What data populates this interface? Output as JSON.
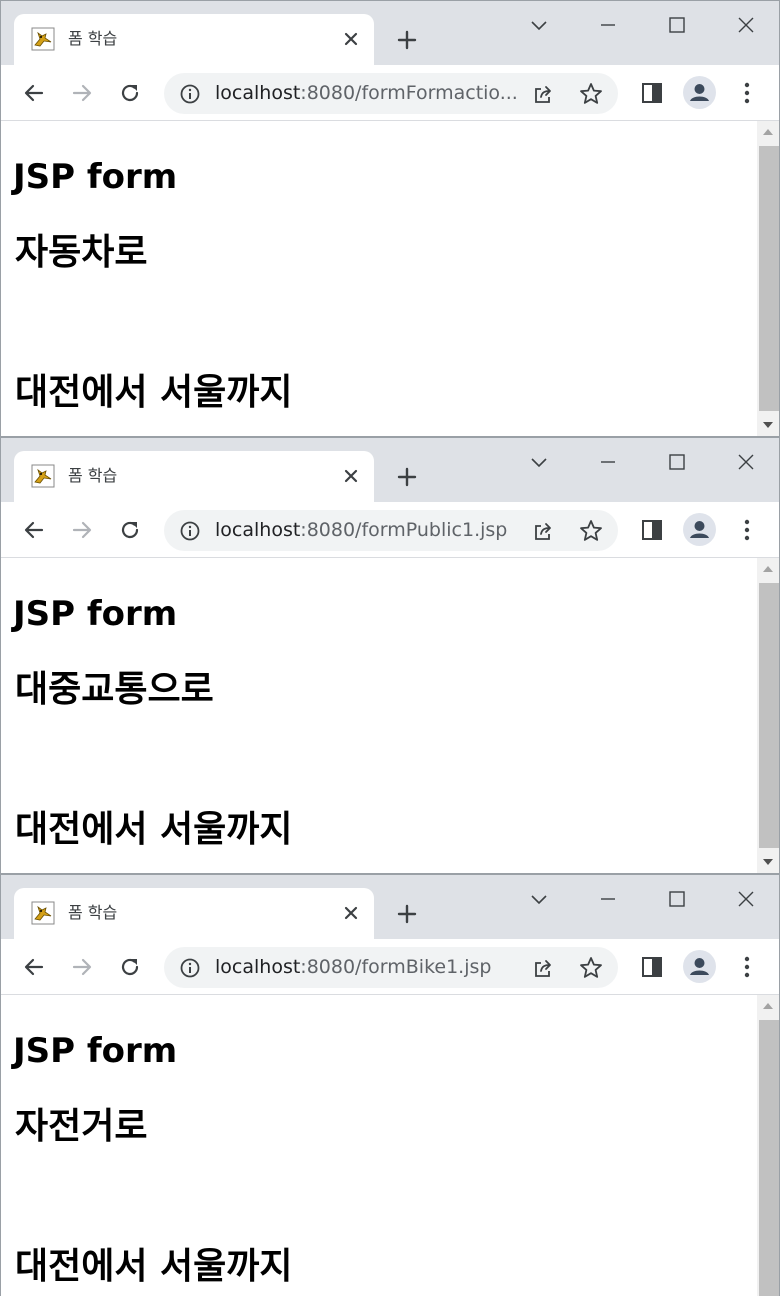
{
  "windows": [
    {
      "tab_title": "폼 학습",
      "url_host": "localhost",
      "url_path": ":8080/formFormactio...",
      "heading": "JSP form",
      "transport": "자동차로",
      "route": "대전에서 서울까지"
    },
    {
      "tab_title": "폼 학습",
      "url_host": "localhost",
      "url_path": ":8080/formPublic1.jsp",
      "heading": "JSP form",
      "transport": "대중교통으로",
      "route": "대전에서 서울까지"
    },
    {
      "tab_title": "폼 학습",
      "url_host": "localhost",
      "url_path": ":8080/formBike1.jsp",
      "heading": "JSP form",
      "transport": "자전거로",
      "route": "대전에서 서울까지"
    }
  ],
  "icons": {
    "favicon": "tomcat-icon",
    "close": "close-icon",
    "new_tab": "plus-icon",
    "back": "back-arrow-icon",
    "forward": "forward-arrow-icon",
    "reload": "reload-icon",
    "info": "info-icon",
    "share": "share-icon",
    "bookmark": "star-icon",
    "side_panel": "side-panel-icon",
    "profile": "profile-avatar-icon",
    "menu": "kebab-menu-icon"
  },
  "colors": {
    "tabstrip": "#dee1e6",
    "omnibox": "#f1f3f4",
    "scroll_thumb": "#c1c1c1"
  }
}
